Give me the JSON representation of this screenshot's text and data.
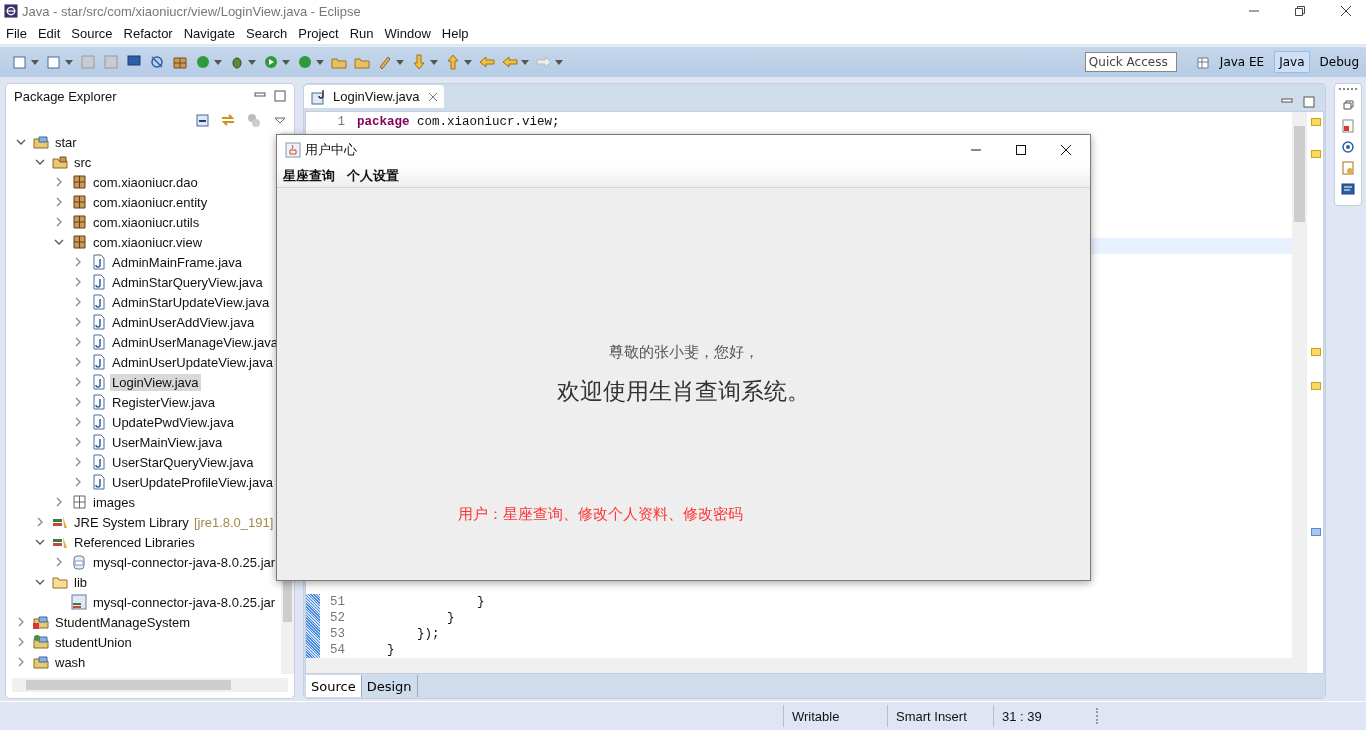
{
  "window": {
    "title": "Java - star/src/com/xiaoniucr/view/LoginView.java - Eclipse"
  },
  "menu": [
    "File",
    "Edit",
    "Source",
    "Refactor",
    "Navigate",
    "Search",
    "Project",
    "Run",
    "Window",
    "Help"
  ],
  "quick_access": {
    "placeholder": "Quick Access"
  },
  "perspectives": [
    {
      "label": "Java EE",
      "selected": false
    },
    {
      "label": "Java",
      "selected": true
    },
    {
      "label": "Debug",
      "selected": false
    }
  ],
  "package_explorer": {
    "title": "Package Explorer",
    "tree": [
      {
        "label": "star",
        "kind": "project",
        "expanded": true,
        "selected": false,
        "children": [
          {
            "label": "src",
            "kind": "source",
            "expanded": true,
            "selected": false,
            "children": [
              {
                "label": "com.xiaoniucr.dao",
                "kind": "package",
                "expanded": false,
                "selected": false
              },
              {
                "label": "com.xiaoniucr.entity",
                "kind": "package",
                "expanded": false,
                "selected": false
              },
              {
                "label": "com.xiaoniucr.utils",
                "kind": "package",
                "expanded": false,
                "selected": false
              },
              {
                "label": "com.xiaoniucr.view",
                "kind": "package",
                "expanded": true,
                "selected": false,
                "children": [
                  {
                    "label": "AdminMainFrame.java",
                    "kind": "java",
                    "expanded": false,
                    "selected": false
                  },
                  {
                    "label": "AdminStarQueryView.java",
                    "kind": "java",
                    "expanded": false,
                    "selected": false
                  },
                  {
                    "label": "AdminStarUpdateView.java",
                    "kind": "java",
                    "expanded": false,
                    "selected": false
                  },
                  {
                    "label": "AdminUserAddView.java",
                    "kind": "java",
                    "expanded": false,
                    "selected": false
                  },
                  {
                    "label": "AdminUserManageView.java",
                    "kind": "java",
                    "expanded": false,
                    "selected": false
                  },
                  {
                    "label": "AdminUserUpdateView.java",
                    "kind": "java",
                    "expanded": false,
                    "selected": false
                  },
                  {
                    "label": "LoginView.java",
                    "kind": "java",
                    "expanded": false,
                    "selected": true
                  },
                  {
                    "label": "RegisterView.java",
                    "kind": "java",
                    "expanded": false,
                    "selected": false
                  },
                  {
                    "label": "UpdatePwdView.java",
                    "kind": "java",
                    "expanded": false,
                    "selected": false
                  },
                  {
                    "label": "UserMainView.java",
                    "kind": "java",
                    "expanded": false,
                    "selected": false
                  },
                  {
                    "label": "UserStarQueryView.java",
                    "kind": "java",
                    "expanded": false,
                    "selected": false
                  },
                  {
                    "label": "UserUpdateProfileView.java",
                    "kind": "java",
                    "expanded": false,
                    "selected": false
                  }
                ]
              },
              {
                "label": "images",
                "kind": "package-empty",
                "expanded": false,
                "selected": false
              }
            ]
          },
          {
            "label": "JRE System Library",
            "decoration": "[jre1.8.0_191]",
            "kind": "library",
            "expanded": false,
            "selected": false
          },
          {
            "label": "Referenced Libraries",
            "kind": "library",
            "expanded": true,
            "selected": false,
            "children": [
              {
                "label": "mysql-connector-java-8.0.25.jar",
                "kind": "jar",
                "expanded": false,
                "selected": false
              }
            ]
          },
          {
            "label": "lib",
            "kind": "folder",
            "expanded": true,
            "selected": false,
            "children": [
              {
                "label": "mysql-connector-java-8.0.25.jar",
                "kind": "jar-file",
                "selected": false
              }
            ]
          }
        ]
      },
      {
        "label": "StudentManageSystem",
        "kind": "project-error",
        "expanded": false,
        "selected": false
      },
      {
        "label": "studentUnion",
        "kind": "project-web",
        "expanded": false,
        "selected": false
      },
      {
        "label": "wash",
        "kind": "project",
        "expanded": false,
        "selected": false
      }
    ]
  },
  "editor": {
    "tab": "LoginView.java",
    "top_lines": [
      {
        "number": "1",
        "keyword": "package",
        "code": " com.xiaoniucr.view;"
      }
    ],
    "bottom_lines": [
      {
        "number": "51",
        "code": "                }"
      },
      {
        "number": "52",
        "code": "            }"
      },
      {
        "number": "53",
        "code": "        });"
      },
      {
        "number": "54",
        "code": "    }"
      }
    ],
    "bottom_tabs": [
      {
        "label": "Source",
        "selected": true
      },
      {
        "label": "Design",
        "selected": false
      }
    ]
  },
  "dialog": {
    "title": "用户中心",
    "menu": [
      "星座查询",
      "个人设置"
    ],
    "greeting": "尊敬的张小斐，您好，",
    "welcome": "欢迎使用生肖查询系统。",
    "note": "用户：星座查询、修改个人资料、修改密码"
  },
  "status_bar": [
    "Writable",
    "Smart Insert",
    "31 : 39"
  ]
}
